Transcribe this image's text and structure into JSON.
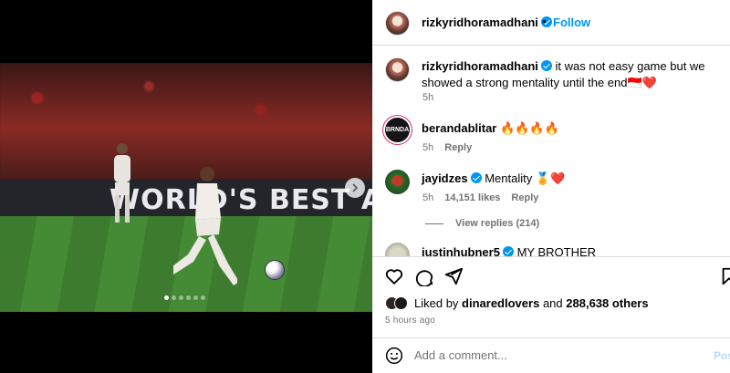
{
  "post": {
    "author": "rizkyridhoramadhani",
    "follow_label": "Follow",
    "separator": "•",
    "caption": "it was not easy game but we showed a strong mentality until the end🇮🇩❤️",
    "caption_time": "5h"
  },
  "media": {
    "board_text": "WORLD'S BEST AIRL",
    "carousel_dots": 6,
    "active_dot": 0,
    "next_icon": "chevron-right-icon"
  },
  "comments": [
    {
      "user": "berandablitar",
      "verified": false,
      "text": "🔥🔥🔥🔥",
      "time": "5h",
      "likes": "",
      "reply_label": "Reply",
      "avatar_text": "BRNDA"
    },
    {
      "user": "jayidzes",
      "verified": true,
      "text": "Mentality 🏅❤️",
      "time": "5h",
      "likes": "14,151 likes",
      "reply_label": "Reply",
      "view_replies": "View replies (214)"
    },
    {
      "user": "justinhubner5",
      "verified": true,
      "text": "MY BROTHER"
    }
  ],
  "actions": {
    "icons": [
      "heart-icon",
      "comment-icon",
      "share-icon",
      "bookmark-icon"
    ],
    "liked_prefix": "Liked by",
    "liked_user": "dinaredlovers",
    "liked_and": "and",
    "liked_count": "288,638 others",
    "time_ago": "5 hours ago"
  },
  "add_comment": {
    "placeholder": "Add a comment...",
    "post_label": "Post",
    "emoji_icon": "smiley-icon"
  },
  "colors": {
    "link_blue": "#0095f6",
    "muted": "#737373",
    "border": "#dbdbdb"
  }
}
